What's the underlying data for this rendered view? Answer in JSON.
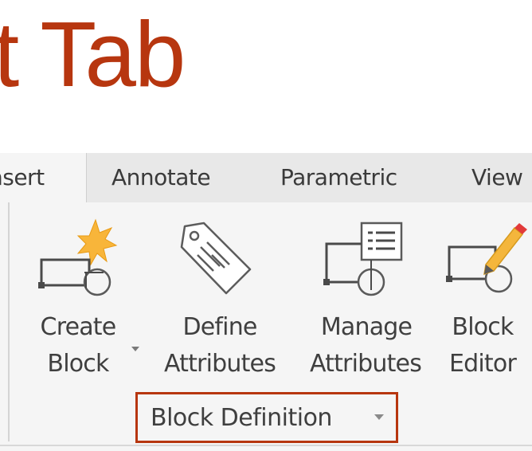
{
  "heading": "t Tab",
  "tabs": [
    {
      "label": "nsert",
      "active": true
    },
    {
      "label": "Annotate",
      "active": false
    },
    {
      "label": "Parametric",
      "active": false
    },
    {
      "label": "View",
      "active": false
    }
  ],
  "buttons": {
    "create": {
      "line1": "Create",
      "line2": "Block",
      "icon": "create-block-icon"
    },
    "define": {
      "line1": "Define",
      "line2": "Attributes",
      "icon": "define-attributes-icon"
    },
    "manage": {
      "line1": "Manage",
      "line2": "Attributes",
      "icon": "manage-attributes-icon"
    },
    "editor": {
      "line1": "Block",
      "line2": "Editor",
      "icon": "block-editor-icon"
    }
  },
  "group": {
    "label": "Block Definition"
  },
  "colors": {
    "accent": "#b7360f",
    "ribbon_bg": "#f5f5f5",
    "tab_bg": "#e8e8e8"
  }
}
